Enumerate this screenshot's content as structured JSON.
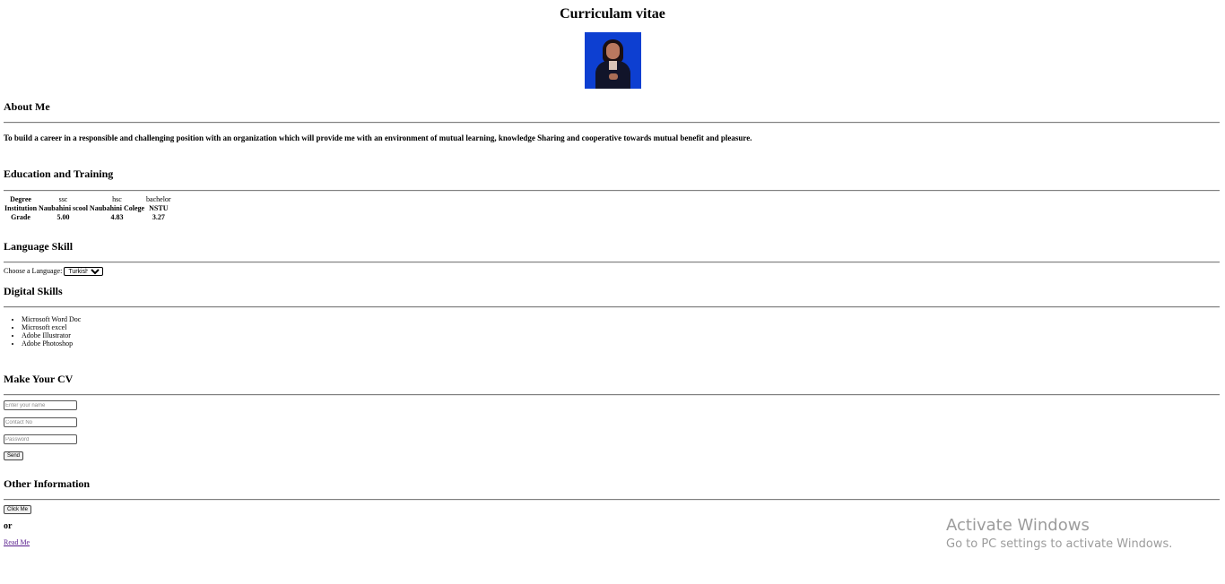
{
  "title": "Curriculam vitae",
  "photo_alt": "profile photo",
  "about": {
    "heading": "About Me",
    "text": "To build a career in a responsible and challenging position with an organization which will provide me with an environment of mutual learning, knowledge Sharing and cooperative towards mutual benefit and pleasure."
  },
  "education": {
    "heading": "Education and Training",
    "table": {
      "header": [
        "Degree",
        "ssc",
        "hsc",
        "bachelor"
      ],
      "rows": [
        [
          "Institution",
          "Naubahini scool",
          "Naubahini Colege",
          "NSTU"
        ],
        [
          "Grade",
          "5.00",
          "4.83",
          "3.27"
        ]
      ]
    }
  },
  "language": {
    "heading": "Language Skill",
    "label": "Choose a Language:",
    "selected": "Turkish"
  },
  "digital": {
    "heading": "Digital Skills",
    "items": [
      "Microsoft Word Doc",
      "Microsoft excel",
      "Adobe Illustrator",
      "Adobe Photoshop"
    ]
  },
  "make_cv": {
    "heading": "Make Your CV",
    "name_placeholder": "Enter your name",
    "contact_placeholder": "Contact No",
    "password_placeholder": "Password",
    "send_label": "Send"
  },
  "other": {
    "heading": "Other Information",
    "click_label": "Click Me",
    "or_text": "or",
    "link_label": "Read Me"
  },
  "watermark": {
    "line1": "Activate Windows",
    "line2": "Go to PC settings to activate Windows."
  }
}
